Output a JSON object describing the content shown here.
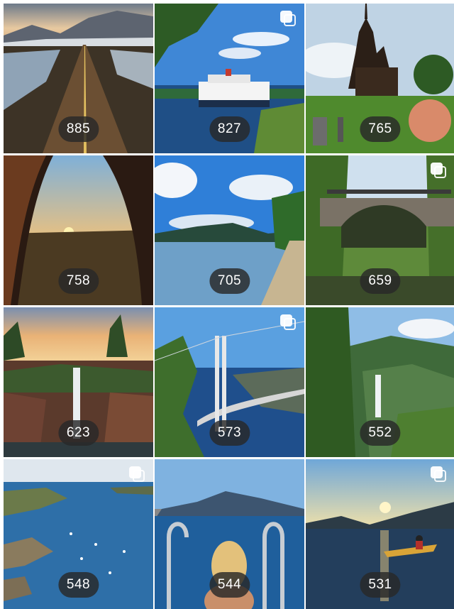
{
  "gallery": {
    "tiles": [
      {
        "count": "885",
        "multi": false,
        "icon": "photo-road"
      },
      {
        "count": "827",
        "multi": true,
        "icon": "photo-ferry"
      },
      {
        "count": "765",
        "multi": false,
        "icon": "photo-stave-church"
      },
      {
        "count": "758",
        "multi": false,
        "icon": "photo-tent-sunset"
      },
      {
        "count": "705",
        "multi": false,
        "icon": "photo-lake"
      },
      {
        "count": "659",
        "multi": true,
        "icon": "photo-stone-bridge"
      },
      {
        "count": "623",
        "multi": false,
        "icon": "photo-waterfall-sunset"
      },
      {
        "count": "573",
        "multi": true,
        "icon": "photo-suspension-bridge"
      },
      {
        "count": "552",
        "multi": false,
        "icon": "photo-waterfall-valley"
      },
      {
        "count": "548",
        "multi": true,
        "icon": "photo-archipelago"
      },
      {
        "count": "544",
        "multi": false,
        "icon": "photo-swim-ladder"
      },
      {
        "count": "531",
        "multi": true,
        "icon": "photo-kayak"
      }
    ]
  },
  "colors": {
    "badge_bg": "#282828",
    "badge_text": "#ffffff"
  }
}
